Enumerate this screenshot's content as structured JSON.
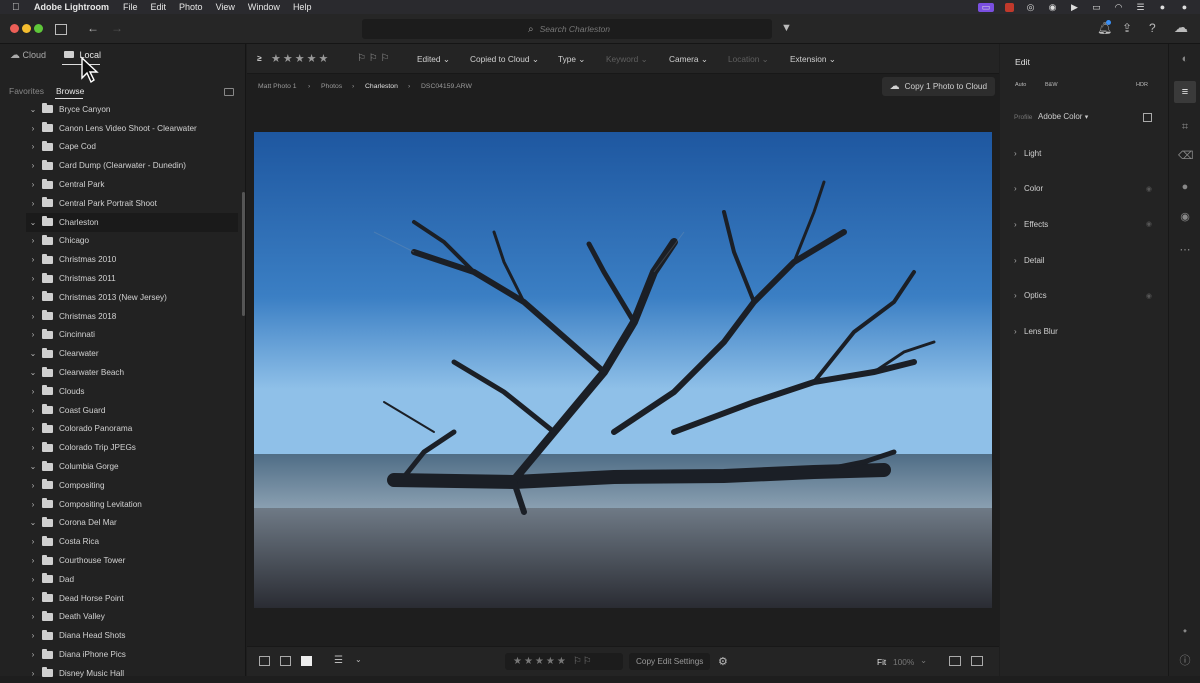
{
  "menubar": {
    "app_name": "Adobe Lightroom",
    "menus": [
      "File",
      "Edit",
      "Photo",
      "View",
      "Window",
      "Help"
    ]
  },
  "titlebar": {
    "search_placeholder": "Search Charleston"
  },
  "left_panel": {
    "tabs": [
      "Cloud",
      "Local"
    ],
    "active_tab": "Local",
    "subtabs": [
      "Favorites",
      "Browse"
    ],
    "active_subtab": "Browse",
    "folders": [
      {
        "label": "Bryce Canyon",
        "expanded": true
      },
      {
        "label": "Canon Lens Video Shoot - Clearwater",
        "expanded": false
      },
      {
        "label": "Cape Cod",
        "expanded": false
      },
      {
        "label": "Card Dump (Clearwater - Dunedin)",
        "expanded": false
      },
      {
        "label": "Central Park",
        "expanded": false
      },
      {
        "label": "Central Park Portrait Shoot",
        "expanded": false
      },
      {
        "label": "Charleston",
        "expanded": true,
        "selected": true
      },
      {
        "label": "Chicago",
        "expanded": false
      },
      {
        "label": "Christmas 2010",
        "expanded": false
      },
      {
        "label": "Christmas 2011",
        "expanded": false
      },
      {
        "label": "Christmas 2013 (New Jersey)",
        "expanded": false
      },
      {
        "label": "Christmas 2018",
        "expanded": false
      },
      {
        "label": "Cincinnati",
        "expanded": false
      },
      {
        "label": "Clearwater",
        "expanded": true
      },
      {
        "label": "Clearwater Beach",
        "expanded": true
      },
      {
        "label": "Clouds",
        "expanded": false
      },
      {
        "label": "Coast Guard",
        "expanded": false
      },
      {
        "label": "Colorado Panorama",
        "expanded": false
      },
      {
        "label": "Colorado Trip JPEGs",
        "expanded": false
      },
      {
        "label": "Columbia Gorge",
        "expanded": true
      },
      {
        "label": "Compositing",
        "expanded": false
      },
      {
        "label": "Compositing Levitation",
        "expanded": false
      },
      {
        "label": "Corona Del Mar",
        "expanded": true
      },
      {
        "label": "Costa Rica",
        "expanded": false
      },
      {
        "label": "Courthouse Tower",
        "expanded": false
      },
      {
        "label": "Dad",
        "expanded": false
      },
      {
        "label": "Dead Horse Point",
        "expanded": false
      },
      {
        "label": "Death Valley",
        "expanded": false
      },
      {
        "label": "Diana Head Shots",
        "expanded": false
      },
      {
        "label": "Diana iPhone Pics",
        "expanded": false
      },
      {
        "label": "Disney Music Hall",
        "expanded": false
      }
    ]
  },
  "filterbar": {
    "rating_op": "≥",
    "filters": [
      {
        "label": "Edited",
        "enabled": true
      },
      {
        "label": "Copied to Cloud",
        "enabled": true
      },
      {
        "label": "Type",
        "enabled": true
      },
      {
        "label": "Keyword",
        "enabled": false
      },
      {
        "label": "Camera",
        "enabled": true
      },
      {
        "label": "Location",
        "enabled": false
      },
      {
        "label": "Extension",
        "enabled": true
      }
    ]
  },
  "breadcrumb": {
    "items": [
      "Matt Photo 1",
      "Photos",
      "Charleston",
      "DSC04159.ARW"
    ],
    "copy_button": "Copy 1 Photo to Cloud"
  },
  "bottombar": {
    "copy_edit": "Copy Edit Settings",
    "fit": "Fit",
    "zoom": "100%"
  },
  "edit_panel": {
    "title": "Edit",
    "auto": "Auto",
    "bw": "B&W",
    "hdr": "HDR",
    "profile_label": "Profile",
    "profile_value": "Adobe Color",
    "sections": [
      "Light",
      "Color",
      "Effects",
      "Detail",
      "Optics",
      "Lens Blur"
    ]
  }
}
